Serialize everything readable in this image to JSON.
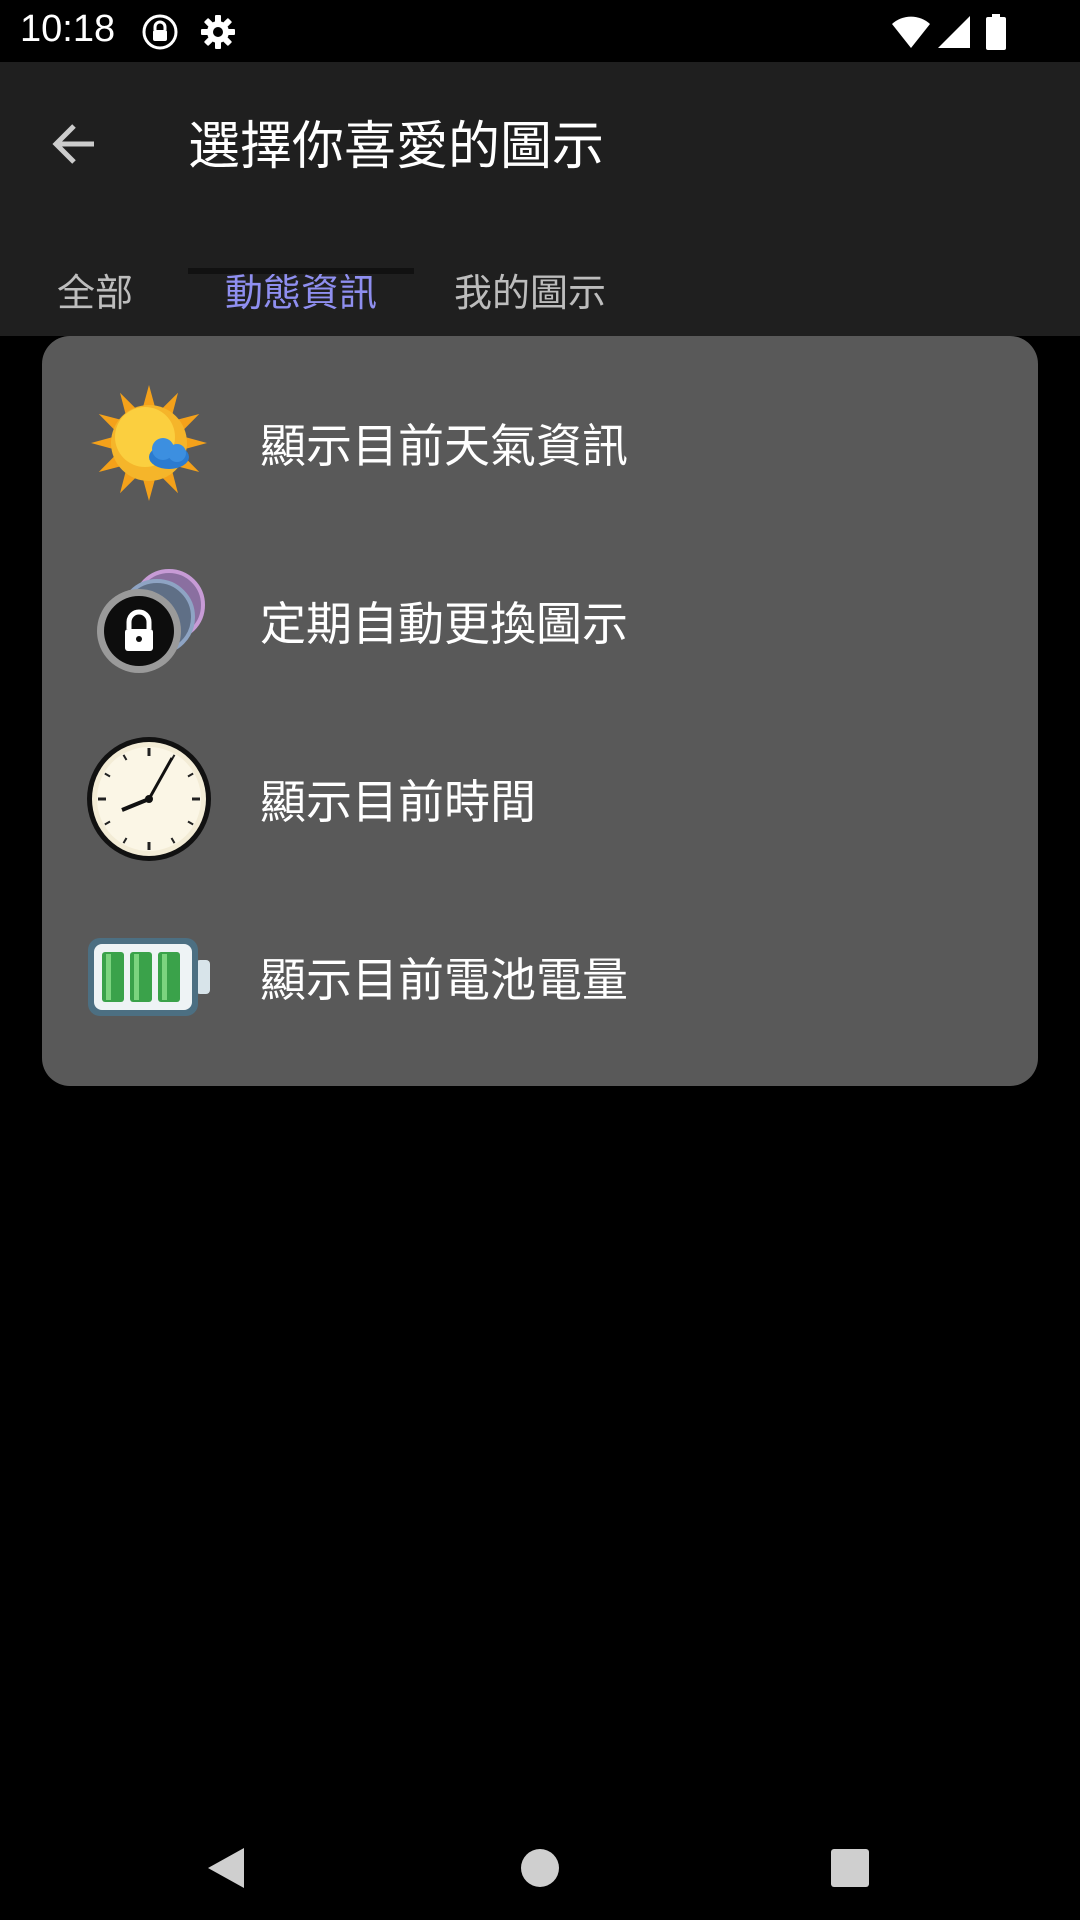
{
  "status_bar": {
    "time": "10:18",
    "icons": [
      "lock-circle-icon",
      "gear-icon",
      "wifi-icon",
      "signal-icon",
      "battery-icon"
    ]
  },
  "header": {
    "title": "選擇你喜愛的圖示",
    "back_icon": "arrow-left-icon"
  },
  "tabs": [
    {
      "label": "全部",
      "active": false
    },
    {
      "label": "動態資訊",
      "active": true
    },
    {
      "label": "我的圖示",
      "active": false
    }
  ],
  "list": {
    "items": [
      {
        "label": "顯示目前天氣資訊",
        "icon": "weather-sun-cloud-icon"
      },
      {
        "label": "定期自動更換圖示",
        "icon": "rotating-lock-icon"
      },
      {
        "label": "顯示目前時間",
        "icon": "clock-icon"
      },
      {
        "label": "顯示目前電池電量",
        "icon": "battery-level-icon"
      }
    ]
  },
  "nav_bar": {
    "buttons": [
      "back-triangle-icon",
      "home-circle-icon",
      "recents-square-icon"
    ]
  },
  "colors": {
    "accent": "#8f8ff0",
    "card": "#595959",
    "app_bar": "#1f1f1f",
    "background": "#000000"
  }
}
